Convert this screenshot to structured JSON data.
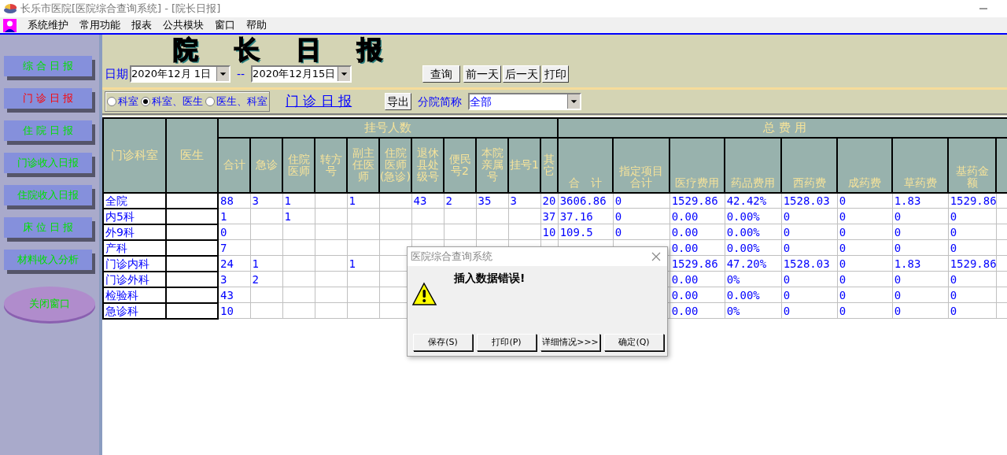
{
  "window": {
    "title": "长乐市医院[医院综合查询系统] - [院长日报]"
  },
  "menu": [
    "系统维护",
    "常用功能",
    "报表",
    "公共模块",
    "窗口",
    "帮助"
  ],
  "sidebar": {
    "buttons": [
      {
        "label": "综 合 日 报",
        "selected": false
      },
      {
        "label": "门 诊 日 报",
        "selected": true
      },
      {
        "label": "住 院 日 报",
        "selected": false
      },
      {
        "label": "门诊收入日报",
        "selected": false
      },
      {
        "label": "住院收入日报",
        "selected": false
      },
      {
        "label": "床 位 日 报",
        "selected": false
      },
      {
        "label": "材料收入分析",
        "selected": false
      }
    ],
    "close_button": "关闭窗口"
  },
  "report_title": "院长日报",
  "date": {
    "label": "日期",
    "from": "2020年12月 1日",
    "separator": "--",
    "to": "2020年12月15日"
  },
  "buttons": [
    "查询",
    "前一天",
    "后一天",
    "打印"
  ],
  "view_options": [
    {
      "label": "科室",
      "selected": false
    },
    {
      "label": "科室、医生",
      "selected": true
    },
    {
      "label": "医生、科室",
      "selected": false
    }
  ],
  "report_link": "门 诊 日 报",
  "export_button": "导出",
  "branch": {
    "label": "分院简称",
    "value": "全部"
  },
  "table": {
    "fixed_columns": [
      "门诊科室",
      "医生"
    ],
    "column_groups": [
      {
        "label": "挂号人数",
        "columns": [
          "合计",
          "急诊",
          "住院医师",
          "转方号",
          "副主任医师",
          "住院医师(急诊)",
          "退休县处级号",
          "便民号2",
          "本院亲属号",
          "挂号1",
          "其它"
        ]
      },
      {
        "label": "总 费 用",
        "columns": [
          "合　计",
          "指定项目合计",
          "医疗费用",
          "药品费用",
          "西药费",
          "成药费",
          "草药费",
          "基药金额"
        ]
      }
    ],
    "rows": [
      [
        "全院",
        null,
        "88",
        "3",
        "1",
        null,
        "1",
        null,
        "43",
        "2",
        "35",
        "3",
        "20",
        "3606.86",
        "0",
        "1529.86",
        "42.42%",
        "1528.03",
        "0",
        "1.83",
        "1529.86"
      ],
      [
        "内5科",
        null,
        "1",
        null,
        "1",
        null,
        null,
        null,
        null,
        null,
        null,
        null,
        "37",
        "37.16",
        "0",
        "0.00",
        "0.00%",
        "0",
        "0",
        "0",
        "0"
      ],
      [
        "外9科",
        null,
        "0",
        null,
        null,
        null,
        null,
        null,
        null,
        null,
        null,
        null,
        "10",
        "109.5",
        "0",
        "0.00",
        "0.00%",
        "0",
        "0",
        "0",
        "0"
      ],
      [
        "产科",
        null,
        "7",
        null,
        null,
        null,
        null,
        null,
        null,
        null,
        null,
        null,
        null,
        null,
        null,
        "0.00",
        "0.00%",
        "0",
        "0",
        "0",
        "0"
      ],
      [
        "门诊内科",
        null,
        "24",
        "1",
        null,
        null,
        "1",
        null,
        null,
        null,
        null,
        null,
        null,
        null,
        null,
        "1529.86",
        "47.20%",
        "1528.03",
        "0",
        "1.83",
        "1529.86"
      ],
      [
        "门诊外科",
        null,
        "3",
        "2",
        null,
        null,
        null,
        null,
        null,
        null,
        null,
        null,
        null,
        null,
        null,
        "0.00",
        "0%",
        "0",
        "0",
        "0",
        "0"
      ],
      [
        "检验科",
        null,
        "43",
        null,
        null,
        null,
        null,
        null,
        null,
        null,
        null,
        null,
        null,
        null,
        null,
        "0.00",
        "0.00%",
        "0",
        "0",
        "0",
        "0"
      ],
      [
        "急诊科",
        null,
        "10",
        null,
        null,
        null,
        null,
        null,
        null,
        null,
        null,
        null,
        null,
        null,
        null,
        "0.00",
        "0%",
        "0",
        "0",
        "0",
        "0"
      ]
    ]
  },
  "dialog": {
    "title": "医院综合查询系统",
    "message": "插入数据错误!",
    "buttons": [
      "保存(S)",
      "打印(P)",
      "详细情况>>>",
      "确定(Q)"
    ]
  }
}
